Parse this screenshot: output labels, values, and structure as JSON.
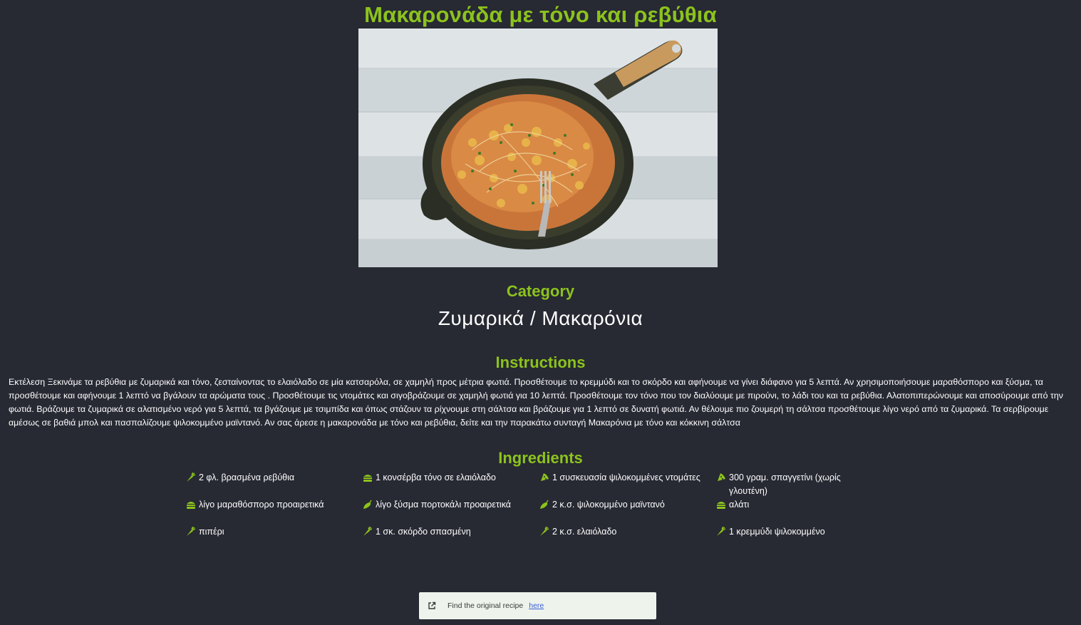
{
  "recipe": {
    "title": "Μακαρονάδα με τόνο και ρεβύθια"
  },
  "category": {
    "heading": "Category",
    "value": "Ζυμαρικά / Μακαρόνια"
  },
  "instructions": {
    "heading": "Instructions",
    "text": "Εκτέλεση Ξεκινάμε τα ρεβύθια με ζυμαρικά και τόνο, ζεσταίνοντας το ελαιόλαδο σε μία κατσαρόλα, σε χαμηλή προς μέτρια φωτιά. Προσθέτουμε το κρεμμύδι και το σκόρδο και αφήνουμε να γίνει διάφανο για 5 λεπτά. Αν χρησιμοποιήσουμε μαραθόσπορο και ξύσμα, τα προσθέτουμε και αφήνουμε 1 λεπτό να βγάλουν τα αρώματα τους . Προσθέτουμε τις ντομάτες και σιγοβράζουμε σε χαμηλή φωτιά για 10 λεπτά. Προσθέτουμε τον τόνο που τον διαλύουμε με πιρούνι, το λάδι του και τα ρεβύθια. Αλατοπιπερώνουμε και αποσύρουμε από την φωτιά. Βράζουμε τα ζυμαρικά σε αλατισμένο νερό για 5 λεπτά, τα βγάζουμε με τσιμπίδα και όπως στάζουν τα ρίχνουμε στη σάλτσα και βράζουμε για 1 λεπτό σε δυνατή φωτιά. Αν θέλουμε πιο ζουμερή τη σάλτσα προσθέτουμε λίγο νερό από τα ζυμαρικά. Τα σερβίρουμε αμέσως σε βαθιά μπολ και πασπαλίζουμε ψιλοκομμένο μαϊντανό. Αν σας άρεσε η μακαρονάδα με τόνο και ρεβύθια, δείτε και την παρακάτω συνταγή Μακαρόνια με τόνο και κόκκινη σάλτσα"
  },
  "ingredients": {
    "heading": "Ingredients",
    "items": [
      {
        "icon": "carrot-icon",
        "text": "2 φλ. βρασμένα ρεβύθια"
      },
      {
        "icon": "burger-icon",
        "text": "1 κονσέρβα τόνο σε ελαιόλαδο"
      },
      {
        "icon": "pizza-icon",
        "text": "1 συσκευασία ψιλοκομμένες ντομάτες"
      },
      {
        "icon": "pizza-icon",
        "text": "300 γραμ. σπαγγετίνι (χωρίς γλουτένη)"
      },
      {
        "icon": "burger-icon",
        "text": "λίγο μαραθόσπορο προαιρετικά"
      },
      {
        "icon": "pepper-icon",
        "text": "λίγο ξύσμα πορτοκάλι προαιρετικά"
      },
      {
        "icon": "pepper-icon",
        "text": "2 κ.σ. ψιλοκομμένο μαϊντανό"
      },
      {
        "icon": "burger-icon",
        "text": "αλάτι"
      },
      {
        "icon": "carrot-icon",
        "text": "πιπέρι"
      },
      {
        "icon": "carrot-icon",
        "text": "1 σκ. σκόρδο σπασμένη"
      },
      {
        "icon": "carrot-icon",
        "text": "2 κ.σ. ελαιόλαδο"
      },
      {
        "icon": "carrot-icon",
        "text": "1 κρεμμύδι ψιλοκομμένο"
      }
    ]
  },
  "source_link": {
    "label": "Find the original recipe",
    "link_text": "here",
    "icon": "external-link-icon"
  },
  "colors": {
    "background": "#272933",
    "accent": "#8cc31c",
    "link": "#3b5fd9",
    "link_box": "#eef3ec"
  }
}
